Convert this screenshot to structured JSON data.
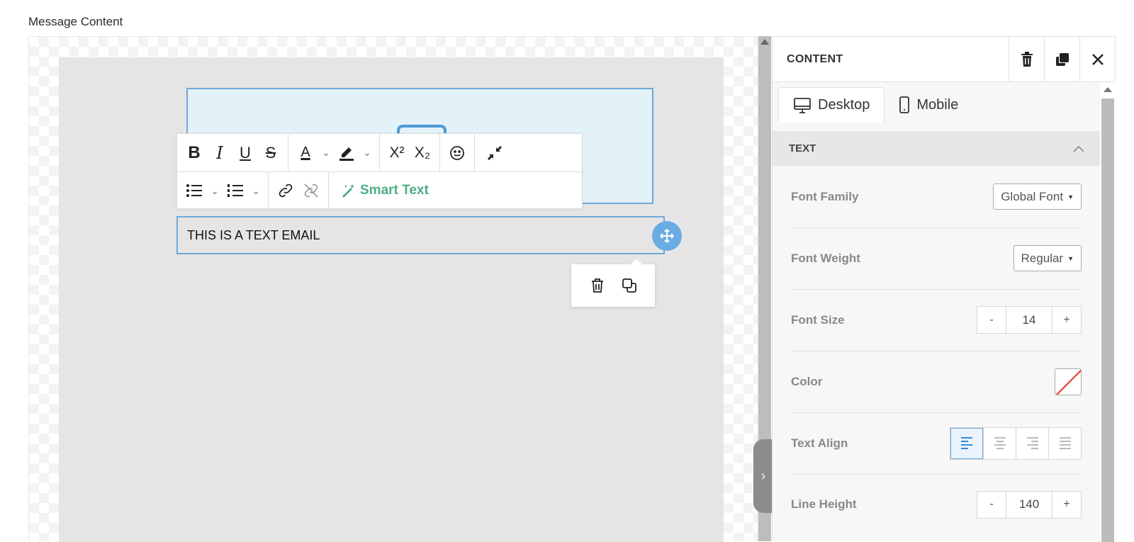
{
  "page": {
    "label": "Message Content"
  },
  "editor": {
    "text_block": {
      "content": "THIS IS A TEXT EMAIL"
    },
    "toolbar": {
      "bold": "B",
      "italic": "I",
      "underline": "U",
      "strikethrough": "S",
      "font_color_letter": "A",
      "superscript": "X²",
      "subscript": "X₂",
      "smart_text_label": "Smart Text"
    }
  },
  "panel": {
    "title": "CONTENT",
    "tabs": [
      {
        "label": "Desktop",
        "active": true
      },
      {
        "label": "Mobile",
        "active": false
      }
    ],
    "section": {
      "title": "TEXT",
      "expanded": true
    },
    "properties": {
      "font_family": {
        "label": "Font Family",
        "value": "Global Font"
      },
      "font_weight": {
        "label": "Font Weight",
        "value": "Regular"
      },
      "font_size": {
        "label": "Font Size",
        "value": "14",
        "minus": "-",
        "plus": "+"
      },
      "color": {
        "label": "Color",
        "value": "none"
      },
      "text_align": {
        "label": "Text Align",
        "selected": "left"
      },
      "line_height": {
        "label": "Line Height",
        "value": "140",
        "minus": "-",
        "plus": "+"
      }
    }
  },
  "colors": {
    "accent_blue": "#6aabe4",
    "smart_text_green": "#4cae84",
    "no_color_red": "#e0312a"
  }
}
